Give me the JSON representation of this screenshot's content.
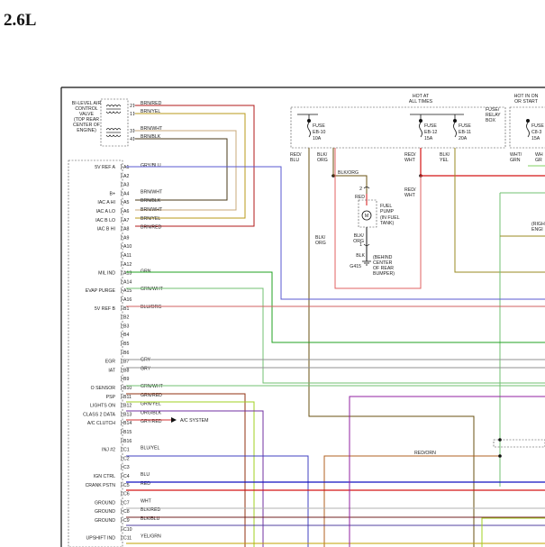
{
  "title": "2.6L",
  "bilevel_valve": [
    "BI-LEVEL AIR",
    "CONTROL",
    "VALVE",
    "(TOP REAR",
    "CENTER OF",
    "ENGINE)"
  ],
  "valve_pins": [
    {
      "pin": "2",
      "wire": "BRN/RED"
    },
    {
      "pin": "1",
      "wire": "BRN/YEL"
    },
    {
      "pin": "3",
      "wire": "BRN/WHT"
    },
    {
      "pin": "4",
      "wire": "BRN/BLK"
    }
  ],
  "hot_at_all_times": [
    "HOT AT",
    "ALL TIMES"
  ],
  "hot_in_on": [
    "HOT IN ON",
    "OR START"
  ],
  "relay_box": [
    "FUSE/",
    "RELAY",
    "BOX"
  ],
  "fuses": [
    {
      "lines": [
        "FUSE",
        "EB-10",
        "10A"
      ]
    },
    {
      "lines": [
        "FUSE",
        "EB-12",
        "15A"
      ]
    },
    {
      "lines": [
        "FUSE",
        "EB-11",
        "20A"
      ]
    },
    {
      "lines": [
        "FUSE",
        "C8-3",
        "15A"
      ]
    }
  ],
  "fuse_wires": [
    {
      "lines": [
        "RED/",
        "BLU"
      ]
    },
    {
      "lines": [
        "BLK/",
        "ORG"
      ]
    },
    {
      "lines": [
        "RED/",
        "WHT"
      ]
    },
    {
      "lines": [
        "BLK/",
        "YEL"
      ]
    },
    {
      "lines": [
        "WHT/",
        "GRN"
      ]
    },
    {
      "lines": [
        "WH",
        "GR"
      ]
    }
  ],
  "fuel_pump": {
    "wire_top": "BLK/ORG",
    "pin_top": "2",
    "wire_red": "RED",
    "label": [
      "FUEL",
      "PUMP",
      "(IN FUEL",
      "TANK)"
    ],
    "wire_left": [
      "BLK/",
      "ORG"
    ],
    "pin_bottom": "1",
    "wire_blk": "BLK",
    "ground_id": "G415",
    "ground_desc": [
      "(BEHIND",
      "CENTER",
      "OF REAR",
      "BUMPER)"
    ]
  },
  "red_wht_right": [
    "RED/",
    "WHT"
  ],
  "right_edge": [
    "(RIGH",
    "ENGI"
  ],
  "ecm_pins": [
    {
      "pin": "A1",
      "label": "5V REF A",
      "wire": "GRY/BLU"
    },
    {
      "pin": "A2",
      "label": "",
      "wire": ""
    },
    {
      "pin": "A3",
      "label": "",
      "wire": ""
    },
    {
      "pin": "A4",
      "label": "B+",
      "wire": "BRN/WHT"
    },
    {
      "pin": "A5",
      "label": "IAC A HI",
      "wire": "BRN/BLK"
    },
    {
      "pin": "A6",
      "label": "IAC A LO",
      "wire": "BRN/WHT"
    },
    {
      "pin": "A7",
      "label": "IAC B LO",
      "wire": "BRN/YEL"
    },
    {
      "pin": "A8",
      "label": "IAC B HI",
      "wire": "BRN/RED"
    },
    {
      "pin": "A9",
      "label": "",
      "wire": ""
    },
    {
      "pin": "A10",
      "label": "",
      "wire": ""
    },
    {
      "pin": "A11",
      "label": "",
      "wire": ""
    },
    {
      "pin": "A12",
      "label": "",
      "wire": ""
    },
    {
      "pin": "A13",
      "label": "MIL IND",
      "wire": "GRN"
    },
    {
      "pin": "A14",
      "label": "",
      "wire": ""
    },
    {
      "pin": "A15",
      "label": "EVAP PURGE",
      "wire": "GRN/WHT"
    },
    {
      "pin": "A16",
      "label": "",
      "wire": ""
    },
    {
      "pin": "B1",
      "label": "5V REF B",
      "wire": "BLU/ORG"
    },
    {
      "pin": "B2",
      "label": "",
      "wire": ""
    },
    {
      "pin": "B3",
      "label": "",
      "wire": ""
    },
    {
      "pin": "B4",
      "label": "",
      "wire": ""
    },
    {
      "pin": "B5",
      "label": "",
      "wire": ""
    },
    {
      "pin": "B6",
      "label": "",
      "wire": ""
    },
    {
      "pin": "B7",
      "label": "EGR",
      "wire": "GRY"
    },
    {
      "pin": "B8",
      "label": "IAT",
      "wire": "GRY"
    },
    {
      "pin": "B9",
      "label": "",
      "wire": ""
    },
    {
      "pin": "B10",
      "label": "O SENSOR",
      "wire": "GRN/WHT"
    },
    {
      "pin": "B11",
      "label": "PSP",
      "wire": "GRN/RED"
    },
    {
      "pin": "B12",
      "label": "LIGHTS ON",
      "wire": "GRN/YEL"
    },
    {
      "pin": "B13",
      "label": "CLASS 2 DATA",
      "wire": "ORG/BLK"
    },
    {
      "pin": "B14",
      "label": "A/C CLUTCH",
      "wire": "GRY/RED"
    },
    {
      "pin": "B15",
      "label": "",
      "wire": ""
    },
    {
      "pin": "B16",
      "label": "",
      "wire": ""
    },
    {
      "pin": "C1",
      "label": "INJ #2",
      "wire": "BLU/YEL"
    },
    {
      "pin": "C2",
      "label": "",
      "wire": ""
    },
    {
      "pin": "C3",
      "label": "",
      "wire": ""
    },
    {
      "pin": "C4",
      "label": "IGN CTRL",
      "wire": "BLU"
    },
    {
      "pin": "C5",
      "label": "CRANK PSTN",
      "wire": "RED"
    },
    {
      "pin": "C6",
      "label": "",
      "wire": ""
    },
    {
      "pin": "C7",
      "label": "GROUND",
      "wire": "WHT"
    },
    {
      "pin": "C8",
      "label": "GROUND",
      "wire": "BLK/RED"
    },
    {
      "pin": "C9",
      "label": "GROUND",
      "wire": "BLK/BLU"
    },
    {
      "pin": "C10",
      "label": "",
      "wire": ""
    },
    {
      "pin": "C11",
      "label": "UPSHIFT IND",
      "wire": "YEL/GRN"
    }
  ],
  "ac_system": "A/C SYSTEM",
  "red_orn": "RED/ORN",
  "colors": {
    "brn_red": "#b01818",
    "brn_yel": "#b89a1a",
    "brn_wht": "#c8a878",
    "brn_blk": "#4a3a1a",
    "gry_blu": "#5a5ad0",
    "blk_org": "#6a5010",
    "red": "#d41414",
    "red_blu": "#9020a0",
    "red_wht": "#e06060",
    "blk_yel": "#909000",
    "wht_grn": "#80d060",
    "grn": "#20a020",
    "grn_wht": "#70c070",
    "blu_org": "#d06060",
    "gry": "#909090",
    "grn_red": "#903010",
    "grn_yel": "#a0d020",
    "org_blk": "#7030a0",
    "gry_red": "#d03030",
    "blu_yel": "#4040c0",
    "blu": "#1010c0",
    "wht": "#b0b0b0",
    "blk_red": "#702020",
    "blk_blu": "#5040a0",
    "yel_grn": "#c0a000",
    "red_orn": "#b06020",
    "olive": "#9a8a20"
  }
}
